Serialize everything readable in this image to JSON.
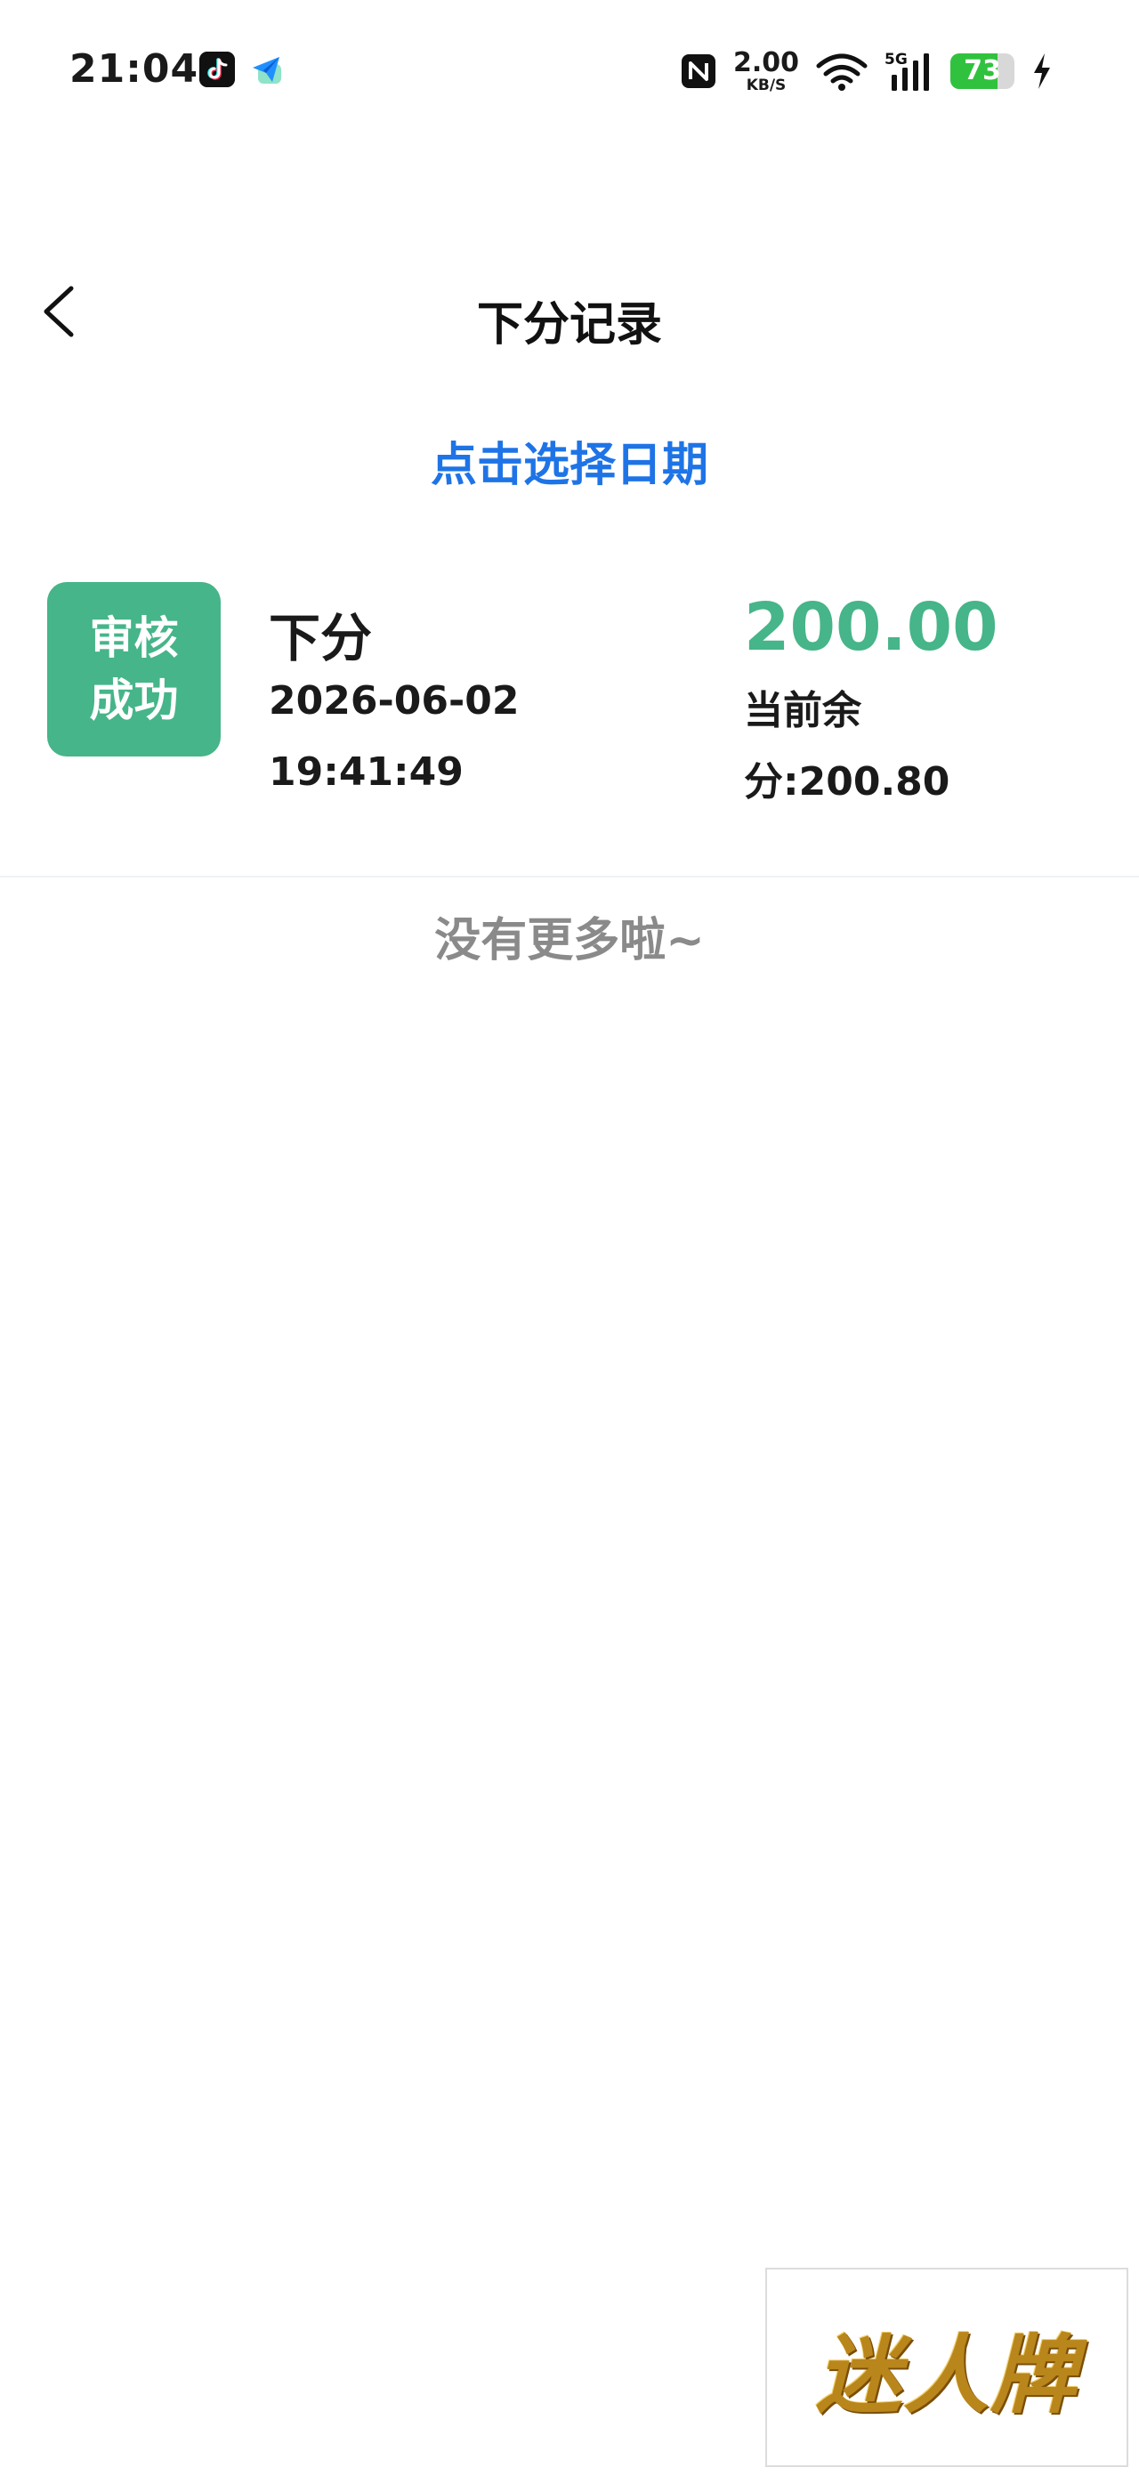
{
  "status_bar": {
    "time": "21:04",
    "app_icons": [
      "tiktok-icon",
      "plane-icon"
    ],
    "net_speed_value": "2.00",
    "net_speed_unit": "KB/S",
    "network_type": "5G",
    "battery_level": 73,
    "battery_label": "73",
    "battery_color": "#30c23e",
    "icons": [
      "nfc-icon",
      "wifi-icon",
      "signal-icon",
      "charging-icon"
    ]
  },
  "nav": {
    "title": "下分记录",
    "back_icon": "chevron-left-icon"
  },
  "date_picker": {
    "label": "点击选择日期",
    "color": "#1e74e6"
  },
  "records": [
    {
      "status_line1": "审核",
      "status_line2": "成功",
      "type": "下分",
      "date": "2026-06-02",
      "time": "19:41:49",
      "amount": "200.00",
      "balance_label": "当前余",
      "balance_value": "分:200.80",
      "accent_color": "#46b589"
    }
  ],
  "list_end_text": "没有更多啦~",
  "watermark": {
    "text": "迷人牌"
  }
}
